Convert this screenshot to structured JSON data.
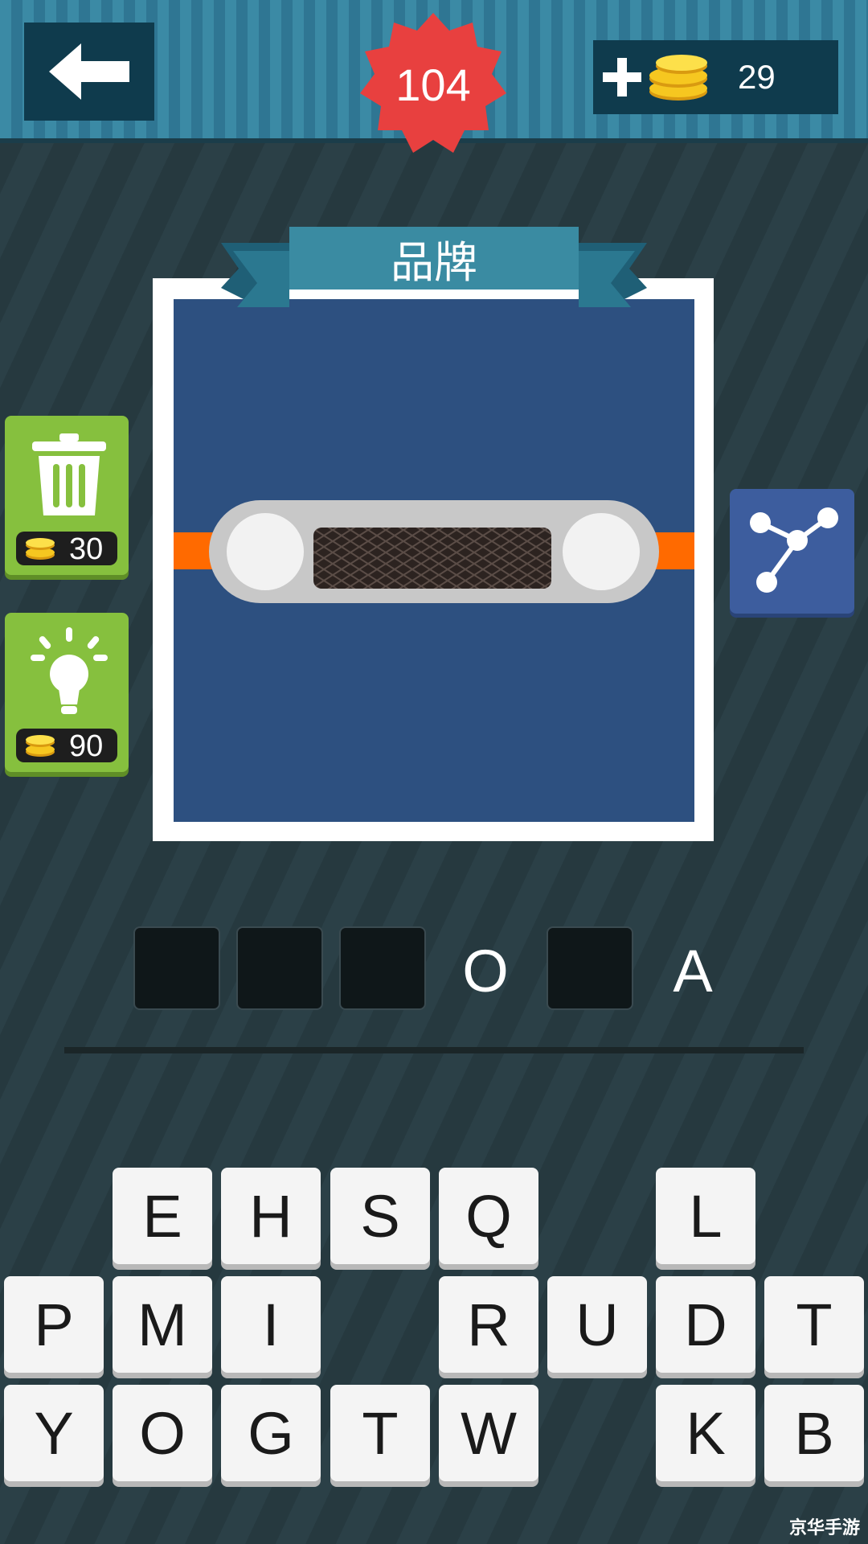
{
  "header": {
    "level": "104",
    "coins": "29"
  },
  "puzzle": {
    "category": "品牌",
    "answer_slots": [
      "",
      "",
      "",
      "O",
      "",
      "A"
    ]
  },
  "hints": [
    {
      "name": "remove-letters",
      "cost": "30"
    },
    {
      "name": "reveal-letter",
      "cost": "90"
    }
  ],
  "keyboard": {
    "row1": [
      "E",
      "H",
      "S",
      "Q",
      "",
      "L",
      ""
    ],
    "row2": [
      "P",
      "M",
      "I",
      "",
      "R",
      "U",
      "D",
      "T"
    ],
    "row3": [
      "Y",
      "O",
      "G",
      "T",
      "W",
      "",
      "K",
      "B"
    ]
  },
  "watermark": "京华手游",
  "colors": {
    "badge": "#e8403f",
    "topbar": "#3b8aa5",
    "hint_button": "#86c03e",
    "share_button": "#3d5d9e",
    "canvas": "#2d5080",
    "accent_orange": "#ff6a00"
  },
  "icons": {
    "back": "arrow-left-icon",
    "coins": "coin-stack-icon",
    "add": "plus-icon",
    "trash": "trash-icon",
    "bulb": "lightbulb-icon",
    "share": "share-icon"
  }
}
